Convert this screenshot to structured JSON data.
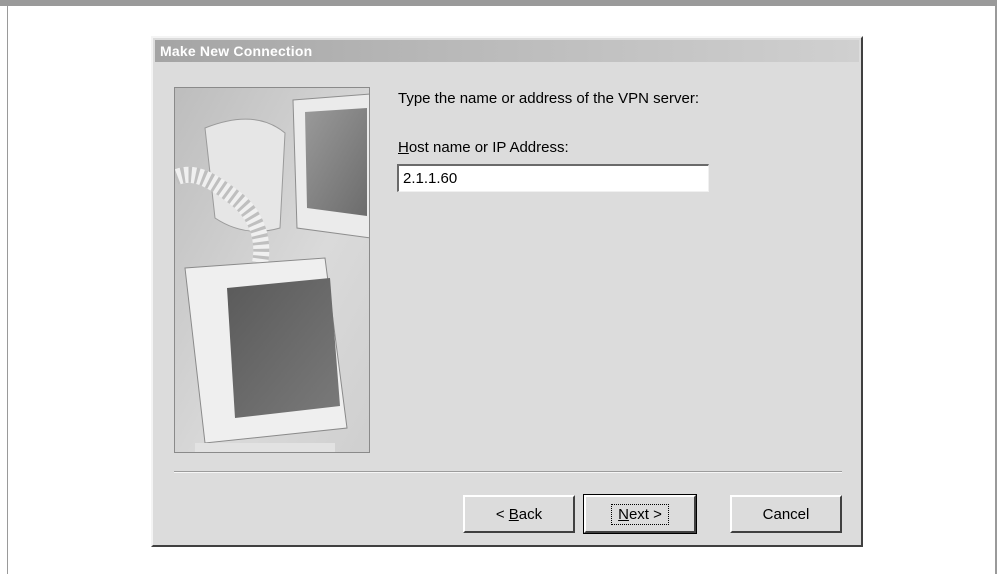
{
  "window": {
    "title": "Make New Connection"
  },
  "wizard": {
    "prompt": "Type the name or address of the VPN server:",
    "host_label_mnemonic": "H",
    "host_label_rest": "ost name or IP Address:",
    "host_value": "2.1.1.60"
  },
  "buttons": {
    "back_prefix": "< ",
    "back_mnemonic": "B",
    "back_rest": "ack",
    "next_mnemonic": "N",
    "next_rest": "ext >",
    "cancel": "Cancel"
  },
  "illustration": {
    "icon": "computer-monitors-illustration"
  }
}
